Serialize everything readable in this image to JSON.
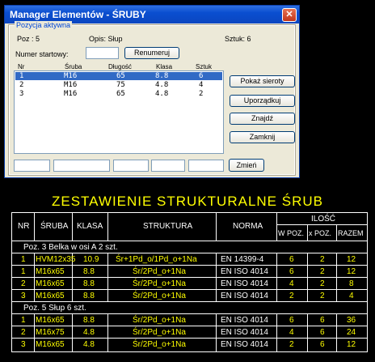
{
  "window": {
    "title": "Manager Elementów - ŚRUBY",
    "close_label": "✕"
  },
  "group": {
    "legend": "Pozycja aktywna",
    "poz": "Poz : 5",
    "opis": "Opis: Słup",
    "sztuk": "Sztuk: 6"
  },
  "start": {
    "label": "Numer startowy:",
    "value": "",
    "renumber_label": "Renumeruj"
  },
  "list": {
    "headers": [
      "Nr",
      "Śruba",
      "Długość",
      "Klasa",
      "Sztuk"
    ],
    "rows": [
      [
        "1",
        "M16",
        "65",
        "8.8",
        "6"
      ],
      [
        "2",
        "M16",
        "75",
        "4.8",
        "4"
      ],
      [
        "3",
        "M16",
        "65",
        "4.8",
        "2"
      ]
    ],
    "selected_index": 0
  },
  "buttons": {
    "show_orphans": "Pokaż sieroty",
    "arrange": "Uporządkuj",
    "find": "Znajdź",
    "close": "Zamknij",
    "change": "Zmień"
  },
  "drawing": {
    "title": "ZESTAWIENIE STRUKTURALNE ŚRUB",
    "headers": {
      "nr": "NR",
      "sruba": "ŚRUBA",
      "klasa": "KLASA",
      "struktura": "STRUKTURA",
      "norma": "NORMA",
      "ilosc": "ILOŚĆ",
      "w_poz": "W POZ.",
      "x_poz": "x POZ.",
      "razem": "RAZEM"
    },
    "groups": [
      {
        "label": "Poz. 3 Belka w osi A 2 szt.",
        "rows": [
          [
            "1",
            "HVM12x35",
            "10.9",
            "Śr+1Pd_o/1Pd_o+1Na",
            "EN 14399-4",
            "6",
            "2",
            "12"
          ],
          [
            "1",
            "M16x65",
            "8.8",
            "Śr/2Pd_o+1Na",
            "EN ISO 4014",
            "6",
            "2",
            "12"
          ],
          [
            "2",
            "M16x65",
            "8.8",
            "Śr/2Pd_o+1Na",
            "EN ISO 4014",
            "4",
            "2",
            "8"
          ],
          [
            "3",
            "M16x65",
            "8.8",
            "Śr/2Pd_o+1Na",
            "EN ISO 4014",
            "2",
            "2",
            "4"
          ]
        ]
      },
      {
        "label": "Poz. 5 Słup 6 szt.",
        "rows": [
          [
            "1",
            "M16x65",
            "8.8",
            "Śr/2Pd_o+1Na",
            "EN ISO 4014",
            "6",
            "6",
            "36"
          ],
          [
            "2",
            "M16x75",
            "4.8",
            "Śr/2Pd_o+1Na",
            "EN ISO 4014",
            "4",
            "6",
            "24"
          ],
          [
            "3",
            "M16x65",
            "4.8",
            "Śr/2Pd_o+1Na",
            "EN ISO 4014",
            "2",
            "6",
            "12"
          ]
        ]
      }
    ]
  }
}
